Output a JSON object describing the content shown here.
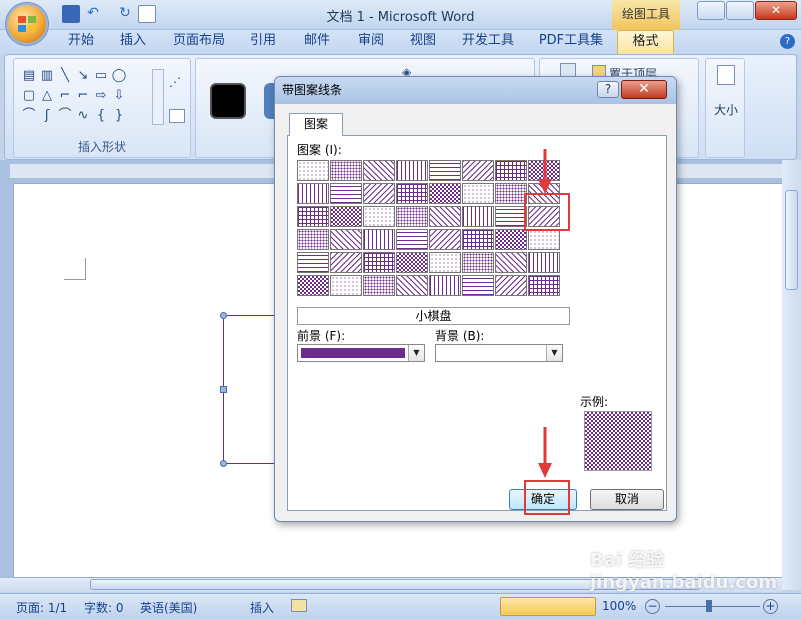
{
  "window": {
    "title": "文档 1 - Microsoft Word",
    "context_tab": "绘图工具"
  },
  "ribbon": {
    "tabs": [
      "开始",
      "插入",
      "页面布局",
      "引用",
      "邮件",
      "审阅",
      "视图",
      "开发工具",
      "PDF工具集",
      "格式"
    ],
    "active_tab": "格式",
    "groups": {
      "insert_shapes": "插入形状",
      "bring_to_front": "置于顶层",
      "size": "大小"
    }
  },
  "dialog": {
    "title": "带图案线条",
    "help": "?",
    "close": "✕",
    "tab": "图案",
    "pattern_label": "图案 (I):",
    "selected_pattern": "小棋盘",
    "foreground_label": "前景 (F):",
    "background_label": "背景 (B):",
    "foreground_color": "#6d2c8a",
    "sample_label": "示例:",
    "ok": "确定",
    "cancel": "取消"
  },
  "statusbar": {
    "page": "页面: 1/1",
    "words": "字数: 0",
    "language": "英语(美国)",
    "mode": "插入",
    "zoom": "100%"
  },
  "watermark": "Bai 经验 jingyan.baidu.com",
  "colors": {
    "accent_purple": "#6d2c8a",
    "annotation_red": "#e03a3a"
  }
}
